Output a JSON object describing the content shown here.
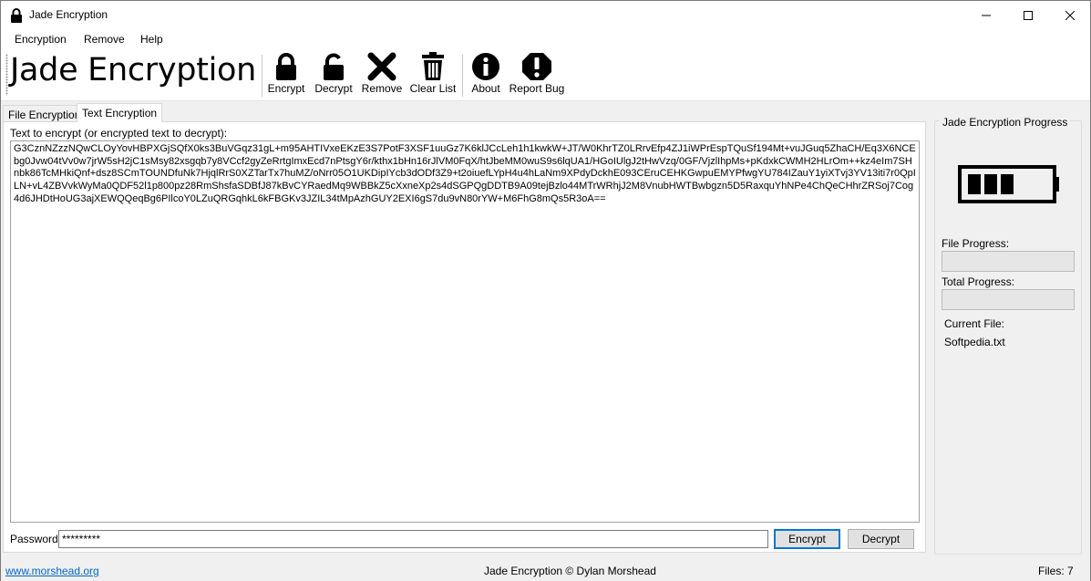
{
  "window": {
    "title": "Jade Encryption",
    "icon": "lock-icon"
  },
  "menu": {
    "items": [
      "Encryption",
      "Remove",
      "Help"
    ]
  },
  "toolbar": {
    "brand": "Jade Encryption",
    "buttons": [
      {
        "label": "Encrypt",
        "icon": "lock-icon"
      },
      {
        "label": "Decrypt",
        "icon": "unlock-icon"
      },
      {
        "label": "Remove",
        "icon": "x-icon"
      },
      {
        "label": "Clear List",
        "icon": "trash-icon"
      },
      {
        "label": "About",
        "icon": "info-icon"
      },
      {
        "label": "Report Bug",
        "icon": "alert-icon"
      }
    ]
  },
  "tabs": {
    "file": "File Encryption",
    "text": "Text Encryption"
  },
  "text_panel": {
    "label": "Text to encrypt (or encrypted text to decrypt):",
    "content": "G3CznNZzzNQwCLOyYovHBPXGjSQfX0ks3BuVGqz31gL+m95AHTIVxeEKzE3S7PotF3XSF1uuGz7K6klJCcLeh1h1kwkW+JT/W0KhrTZ0LRrvEfp4ZJ1iWPrEspTQuSf194Mt+vuJGuq5ZhaCH/Eq3X6NCEbg0Jvw04tVv0w7jrW5sH2jC1sMsy82xsgqb7y8VCcf2gyZeRrtgImxEcd7nPtsgY6r/kthx1bHn16rJlVM0FqX/htJbeMM0wuS9s6lqUA1/HGoIUlgJ2tHwVzq/0GF/VjzlIhpMs+pKdxkCWMH2HLrOm++kz4eIm7SHnbk86TcMHkiQnf+dsz8SCmTOUNDfuNk7HjqlRrS0XZTarTx7huMZ/oNrr05O1UKDipIYcb3dODf3Z9+t2oiuefLYpH4u4hLaNm9XPdyDckhE093CEruCEHKGwpuEMYPfwgYU784IZauY1yiXTvj3YV13iti7r0QpILN+vL4ZBVvkWyMa0QDF52l1p800pz28RmShsfaSDBfJ87kBvCYRaedMq9WBBkZ5cXxneXp2s4dSGPQgDDTB9A09tejBzlo44MTrWRhjJ2M8VnubHWTBwbgzn5D5RaxquYhNPe4ChQeCHhrZRSoj7Cog4d6JHDtHoUG3ajXEWQQeqBg6PIlcoY0LZuQRGqhkL6kFBGKv3JZIL34tMpAzhGUY2EXI6gS7du9vN80rYW+M6FhG8mQs5R3oA=="
  },
  "password": {
    "label": "Password:",
    "value": "*********"
  },
  "actions": {
    "encrypt": "Encrypt",
    "decrypt": "Decrypt"
  },
  "progress": {
    "group_title": "Jade Encryption Progress",
    "icon": "battery-icon",
    "file_label": "File Progress:",
    "file_value": 0,
    "total_label": "Total Progress:",
    "total_value": 0,
    "current_file_label": "Current File:",
    "current_file": "Softpedia.txt"
  },
  "status": {
    "link": "www.morshead.org",
    "center": "Jade Encryption © Dylan Morshead",
    "files": "Files:  7"
  }
}
